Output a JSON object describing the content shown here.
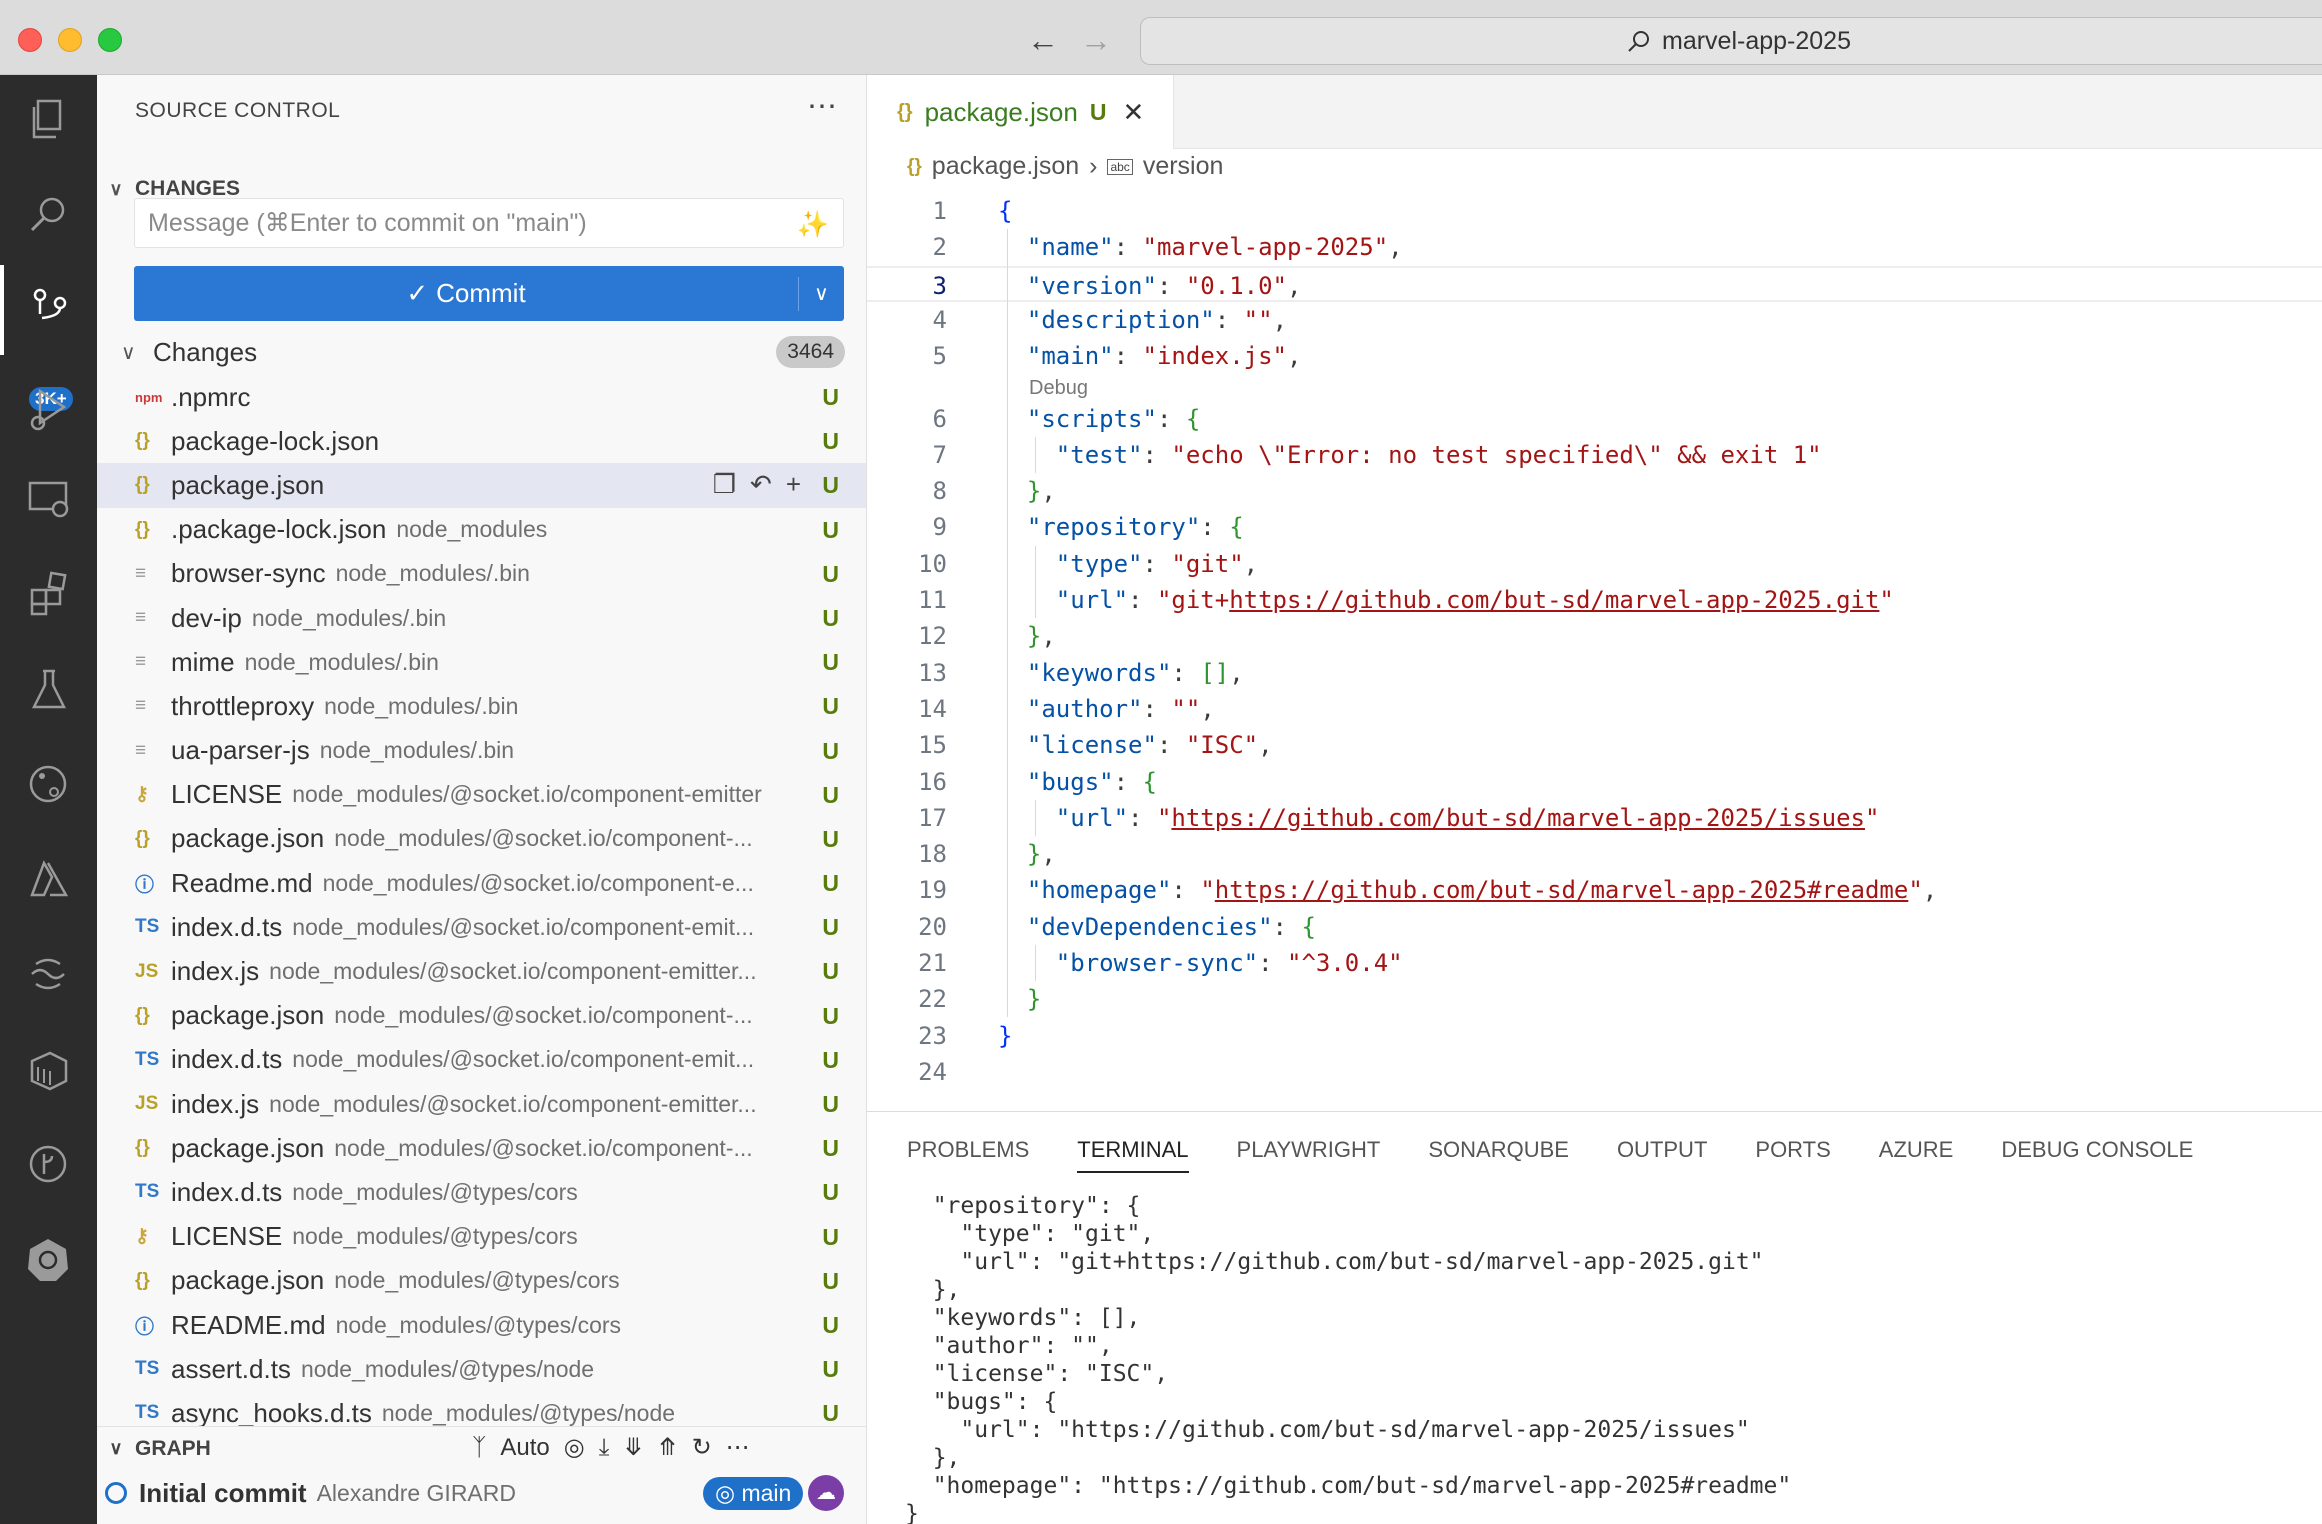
{
  "window": {
    "search_text": "marvel-app-2025"
  },
  "activity": {
    "badge": "3K+"
  },
  "sidebar": {
    "title": "SOURCE CONTROL",
    "section_changes": "CHANGES",
    "message_placeholder": "Message (⌘Enter to commit on \"main\")",
    "commit_label": "Commit",
    "changes_label": "Changes",
    "changes_count": "3464",
    "files": [
      {
        "icon": "npm",
        "glyph": "npm",
        "name": ".npmrc",
        "path": "",
        "status": "U"
      },
      {
        "icon": "json",
        "glyph": "{}",
        "name": "package-lock.json",
        "path": "",
        "status": "U"
      },
      {
        "icon": "json",
        "glyph": "{}",
        "name": "package.json",
        "path": "",
        "status": "U"
      },
      {
        "icon": "json",
        "glyph": "{}",
        "name": ".package-lock.json",
        "path": "node_modules",
        "status": "U"
      },
      {
        "icon": "txt",
        "glyph": "≡",
        "name": "browser-sync",
        "path": "node_modules/.bin",
        "status": "U"
      },
      {
        "icon": "txt",
        "glyph": "≡",
        "name": "dev-ip",
        "path": "node_modules/.bin",
        "status": "U"
      },
      {
        "icon": "txt",
        "glyph": "≡",
        "name": "mime",
        "path": "node_modules/.bin",
        "status": "U"
      },
      {
        "icon": "txt",
        "glyph": "≡",
        "name": "throttleproxy",
        "path": "node_modules/.bin",
        "status": "U"
      },
      {
        "icon": "txt",
        "glyph": "≡",
        "name": "ua-parser-js",
        "path": "node_modules/.bin",
        "status": "U"
      },
      {
        "icon": "lic",
        "glyph": "⚷",
        "name": "LICENSE",
        "path": "node_modules/@socket.io/component-emitter",
        "status": "U"
      },
      {
        "icon": "json",
        "glyph": "{}",
        "name": "package.json",
        "path": "node_modules/@socket.io/component-...",
        "status": "U"
      },
      {
        "icon": "info",
        "glyph": "ⓘ",
        "name": "Readme.md",
        "path": "node_modules/@socket.io/component-e...",
        "status": "U"
      },
      {
        "icon": "ts",
        "glyph": "TS",
        "name": "index.d.ts",
        "path": "node_modules/@socket.io/component-emit...",
        "status": "U"
      },
      {
        "icon": "js",
        "glyph": "JS",
        "name": "index.js",
        "path": "node_modules/@socket.io/component-emitter...",
        "status": "U"
      },
      {
        "icon": "json",
        "glyph": "{}",
        "name": "package.json",
        "path": "node_modules/@socket.io/component-...",
        "status": "U"
      },
      {
        "icon": "ts",
        "glyph": "TS",
        "name": "index.d.ts",
        "path": "node_modules/@socket.io/component-emit...",
        "status": "U"
      },
      {
        "icon": "js",
        "glyph": "JS",
        "name": "index.js",
        "path": "node_modules/@socket.io/component-emitter...",
        "status": "U"
      },
      {
        "icon": "json",
        "glyph": "{}",
        "name": "package.json",
        "path": "node_modules/@socket.io/component-...",
        "status": "U"
      },
      {
        "icon": "ts",
        "glyph": "TS",
        "name": "index.d.ts",
        "path": "node_modules/@types/cors",
        "status": "U"
      },
      {
        "icon": "lic",
        "glyph": "⚷",
        "name": "LICENSE",
        "path": "node_modules/@types/cors",
        "status": "U"
      },
      {
        "icon": "json",
        "glyph": "{}",
        "name": "package.json",
        "path": "node_modules/@types/cors",
        "status": "U"
      },
      {
        "icon": "info",
        "glyph": "ⓘ",
        "name": "README.md",
        "path": "node_modules/@types/cors",
        "status": "U"
      },
      {
        "icon": "ts",
        "glyph": "TS",
        "name": "assert.d.ts",
        "path": "node_modules/@types/node",
        "status": "U"
      },
      {
        "icon": "ts",
        "glyph": "TS",
        "name": "async_hooks.d.ts",
        "path": "node_modules/@types/node",
        "status": "U"
      }
    ],
    "graph_label": "GRAPH",
    "graph_auto": "Auto",
    "commit_message": "Initial commit",
    "commit_author": "Alexandre GIRARD",
    "branch": "main"
  },
  "editor": {
    "tab_label": "package.json",
    "tab_status": "U",
    "breadcrumb_file": "package.json",
    "breadcrumb_symbol": "version",
    "codelens": "Debug",
    "lines": [
      {
        "n": "1",
        "html": "<span class='bb'>{</span>"
      },
      {
        "n": "2",
        "html": "  <span class='k'>\"name\"</span><span class='p'>: </span><span class='s'>\"marvel-app-2025\"</span><span class='p'>,</span>"
      },
      {
        "n": "3",
        "html": "  <span class='k'>\"version\"</span><span class='p'>: </span><span class='s'>\"0.1.0\"</span><span class='p'>,</span>"
      },
      {
        "n": "4",
        "html": "  <span class='k'>\"description\"</span><span class='p'>: </span><span class='s'>\"\"</span><span class='p'>,</span>"
      },
      {
        "n": "5",
        "html": "  <span class='k'>\"main\"</span><span class='p'>: </span><span class='s'>\"index.js\"</span><span class='p'>,</span>"
      },
      {
        "n": "6",
        "html": "  <span class='k'>\"scripts\"</span><span class='p'>: </span><span class='b'>{</span>"
      },
      {
        "n": "7",
        "html": "    <span class='k'>\"test\"</span><span class='p'>: </span><span class='s'>\"echo \\\"Error: no test specified\\\" &amp;&amp; exit 1\"</span>"
      },
      {
        "n": "8",
        "html": "  <span class='b'>}</span><span class='p'>,</span>"
      },
      {
        "n": "9",
        "html": "  <span class='k'>\"repository\"</span><span class='p'>: </span><span class='b'>{</span>"
      },
      {
        "n": "10",
        "html": "    <span class='k'>\"type\"</span><span class='p'>: </span><span class='s'>\"git\"</span><span class='p'>,</span>"
      },
      {
        "n": "11",
        "html": "    <span class='k'>\"url\"</span><span class='p'>: </span><span class='s'>\"git+<span class='u'>https://github.com/but-sd/marvel-app-2025.git</span>\"</span>"
      },
      {
        "n": "12",
        "html": "  <span class='b'>}</span><span class='p'>,</span>"
      },
      {
        "n": "13",
        "html": "  <span class='k'>\"keywords\"</span><span class='p'>: </span><span class='b'>[]</span><span class='p'>,</span>"
      },
      {
        "n": "14",
        "html": "  <span class='k'>\"author\"</span><span class='p'>: </span><span class='s'>\"\"</span><span class='p'>,</span>"
      },
      {
        "n": "15",
        "html": "  <span class='k'>\"license\"</span><span class='p'>: </span><span class='s'>\"ISC\"</span><span class='p'>,</span>"
      },
      {
        "n": "16",
        "html": "  <span class='k'>\"bugs\"</span><span class='p'>: </span><span class='b'>{</span>"
      },
      {
        "n": "17",
        "html": "    <span class='k'>\"url\"</span><span class='p'>: </span><span class='s'>\"<span class='u'>https://github.com/but-sd/marvel-app-2025/issues</span>\"</span>"
      },
      {
        "n": "18",
        "html": "  <span class='b'>}</span><span class='p'>,</span>"
      },
      {
        "n": "19",
        "html": "  <span class='k'>\"homepage\"</span><span class='p'>: </span><span class='s'>\"<span class='u'>https://github.com/but-sd/marvel-app-2025#readme</span>\"</span><span class='p'>,</span>"
      },
      {
        "n": "20",
        "html": "  <span class='k'>\"devDependencies\"</span><span class='p'>: </span><span class='b'>{</span>"
      },
      {
        "n": "21",
        "html": "    <span class='k'>\"browser-sync\"</span><span class='p'>: </span><span class='s'>\"^3.0.4\"</span>"
      },
      {
        "n": "22",
        "html": "  <span class='b'>}</span>"
      },
      {
        "n": "23",
        "html": "<span class='bb'>}</span>"
      },
      {
        "n": "24",
        "html": ""
      }
    ]
  },
  "panel": {
    "tabs": [
      "PROBLEMS",
      "TERMINAL",
      "PLAYWRIGHT",
      "SONARQUBE",
      "OUTPUT",
      "PORTS",
      "AZURE",
      "DEBUG CONSOLE"
    ],
    "active_tab": "TERMINAL",
    "terminal": "  \"repository\": {\n    \"type\": \"git\",\n    \"url\": \"git+https://github.com/but-sd/marvel-app-2025.git\"\n  },\n  \"keywords\": [],\n  \"author\": \"\",\n  \"license\": \"ISC\",\n  \"bugs\": {\n    \"url\": \"https://github.com/but-sd/marvel-app-2025/issues\"\n  },\n  \"homepage\": \"https://github.com/but-sd/marvel-app-2025#readme\"\n}"
  }
}
